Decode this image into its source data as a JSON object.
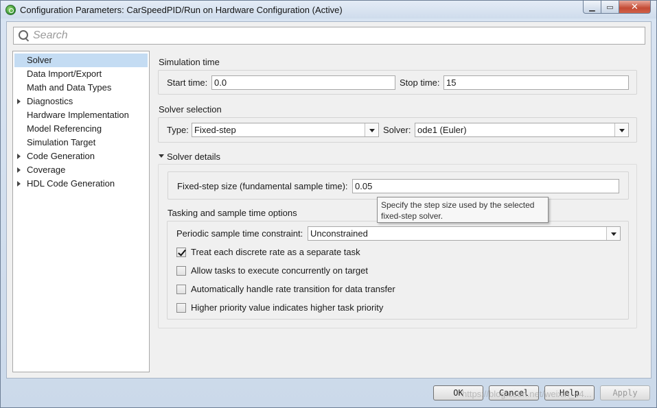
{
  "window": {
    "title": "Configuration Parameters: CarSpeedPID/Run on Hardware Configuration (Active)"
  },
  "search": {
    "placeholder": "Search"
  },
  "tree": {
    "items": [
      {
        "label": "Solver",
        "selected": true,
        "expandable": false
      },
      {
        "label": "Data Import/Export",
        "expandable": false
      },
      {
        "label": "Math and Data Types",
        "expandable": false
      },
      {
        "label": "Diagnostics",
        "expandable": true
      },
      {
        "label": "Hardware Implementation",
        "expandable": false
      },
      {
        "label": "Model Referencing",
        "expandable": false
      },
      {
        "label": "Simulation Target",
        "expandable": false
      },
      {
        "label": "Code Generation",
        "expandable": true
      },
      {
        "label": "Coverage",
        "expandable": true
      },
      {
        "label": "HDL Code Generation",
        "expandable": true
      }
    ]
  },
  "simulation_time": {
    "title": "Simulation time",
    "start_label": "Start time:",
    "start_value": "0.0",
    "stop_label": "Stop time:",
    "stop_value": "15"
  },
  "solver_selection": {
    "title": "Solver selection",
    "type_label": "Type:",
    "type_value": "Fixed-step",
    "solver_label": "Solver:",
    "solver_value": "ode1 (Euler)"
  },
  "solver_details": {
    "title": "Solver details",
    "step_label": "Fixed-step size (fundamental sample time):",
    "step_value": "0.05",
    "tooltip_line1": "Specify the step size used by the selected",
    "tooltip_line2": "fixed-step solver."
  },
  "tasking": {
    "title": "Tasking and sample time options",
    "constraint_label": "Periodic sample time constraint:",
    "constraint_value": "Unconstrained",
    "checkboxes": [
      {
        "label": "Treat each discrete rate as a separate task",
        "checked": true
      },
      {
        "label": "Allow tasks to execute concurrently on target",
        "checked": false
      },
      {
        "label": "Automatically handle rate transition for data transfer",
        "checked": false
      },
      {
        "label": "Higher priority value indicates higher task priority",
        "checked": false
      }
    ]
  },
  "footer": {
    "ok": "OK",
    "cancel": "Cancel",
    "help": "Help",
    "apply": "Apply",
    "watermark": "https://blog.csdn.net/weixin_44..."
  }
}
